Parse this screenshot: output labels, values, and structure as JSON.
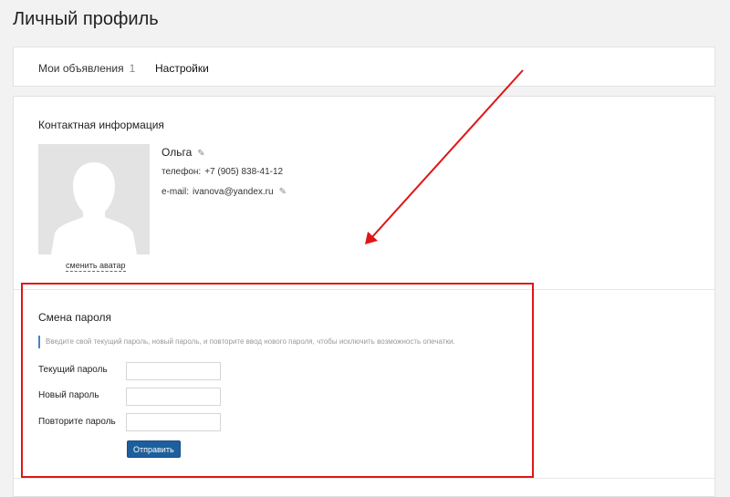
{
  "page": {
    "title": "Личный профиль"
  },
  "tabs": [
    {
      "label": "Мои объявления",
      "count": "1"
    },
    {
      "label": "Настройки"
    }
  ],
  "contacts": {
    "title": "Контактная информация",
    "change_avatar": "сменить аватар",
    "name": "Ольга",
    "phone_label": "телефон:",
    "phone": "+7 (905) 838-41-12",
    "email_label": "e-mail:",
    "email": "ivanova@yandex.ru"
  },
  "password": {
    "title": "Смена пароля",
    "hint": "Введите свой текущий пароль, новый пароль, и повторите ввод нового пароля, чтобы исключить возможность опечатки.",
    "current_label": "Текущий пароль",
    "new_label": "Новый пароль",
    "repeat_label": "Повторите пароль",
    "current_value": "",
    "new_value": "",
    "repeat_value": "",
    "submit_label": "Отправить"
  },
  "colors": {
    "annotation": "#e01515",
    "button": "#1d5f9c",
    "hint_accent": "#4a84b8"
  },
  "icons": {
    "edit": "pencil-icon",
    "avatar": "user-silhouette-icon"
  }
}
